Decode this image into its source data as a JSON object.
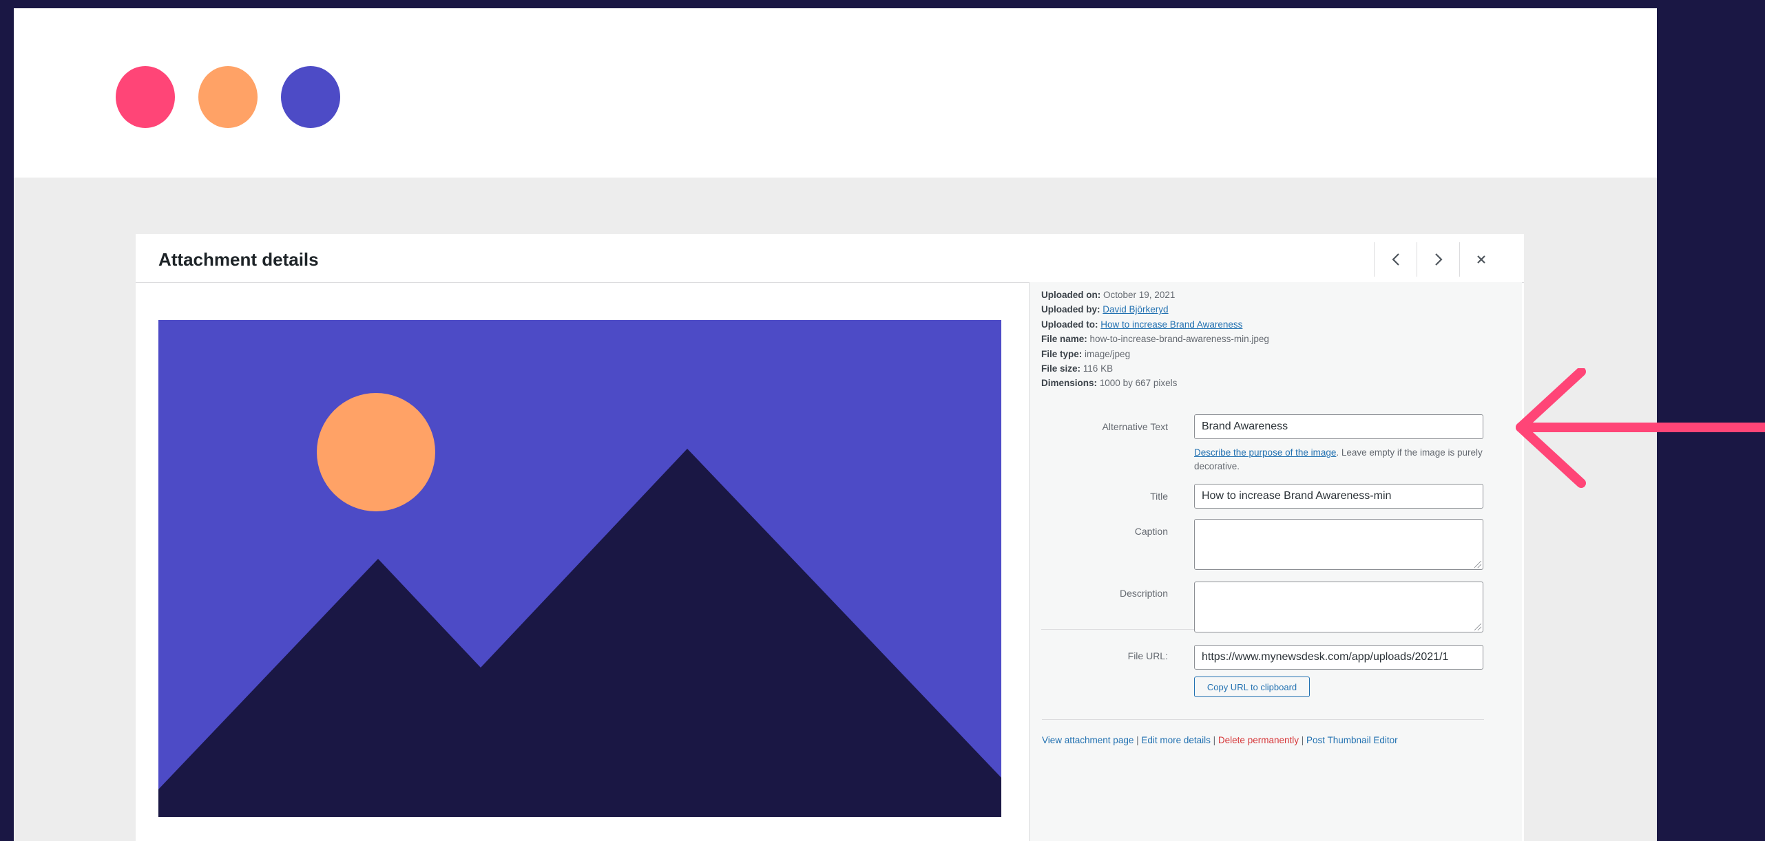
{
  "modal": {
    "title": "Attachment details"
  },
  "file_info": {
    "uploaded_on_label": "Uploaded on:",
    "uploaded_on": "October 19, 2021",
    "uploaded_by_label": "Uploaded by:",
    "uploaded_by": "David Björkeryd",
    "uploaded_to_label": "Uploaded to:",
    "uploaded_to": "How to increase Brand Awareness",
    "file_name_label": "File name:",
    "file_name": "how-to-increase-brand-awareness-min.jpeg",
    "file_type_label": "File type:",
    "file_type": "image/jpeg",
    "file_size_label": "File size:",
    "file_size": "116 KB",
    "dimensions_label": "Dimensions:",
    "dimensions": "1000 by 667 pixels"
  },
  "fields": {
    "alt_label": "Alternative Text",
    "alt_value": "Brand Awareness",
    "alt_help_link": "Describe the purpose of the image",
    "alt_help_rest": ". Leave empty if the image is purely decorative.",
    "title_label": "Title",
    "title_value": "How to increase Brand Awareness-min",
    "caption_label": "Caption",
    "description_label": "Description",
    "url_label": "File URL:",
    "url_value": "https://www.mynewsdesk.com/app/uploads/2021/1",
    "copy_button": "Copy URL to clipboard"
  },
  "actions": {
    "view": "View attachment page",
    "edit": "Edit more details",
    "delete": "Delete permanently",
    "thumbnail": "Post Thumbnail Editor",
    "separator": " | "
  },
  "colors": {
    "background": "#1a1744",
    "dot_red": "#ff4577",
    "dot_orange": "#ffa266",
    "dot_blue": "#4d4bc6",
    "image_sky": "#4d4bc6",
    "image_sun": "#ffa266",
    "image_mountains": "#1a1744",
    "arrow": "#ff4577",
    "link": "#2271b1",
    "delete": "#d63638"
  },
  "icons": {
    "prev": "chevron-left-icon",
    "next": "chevron-right-icon",
    "close": "close-icon",
    "arrow": "arrow-left-icon"
  }
}
